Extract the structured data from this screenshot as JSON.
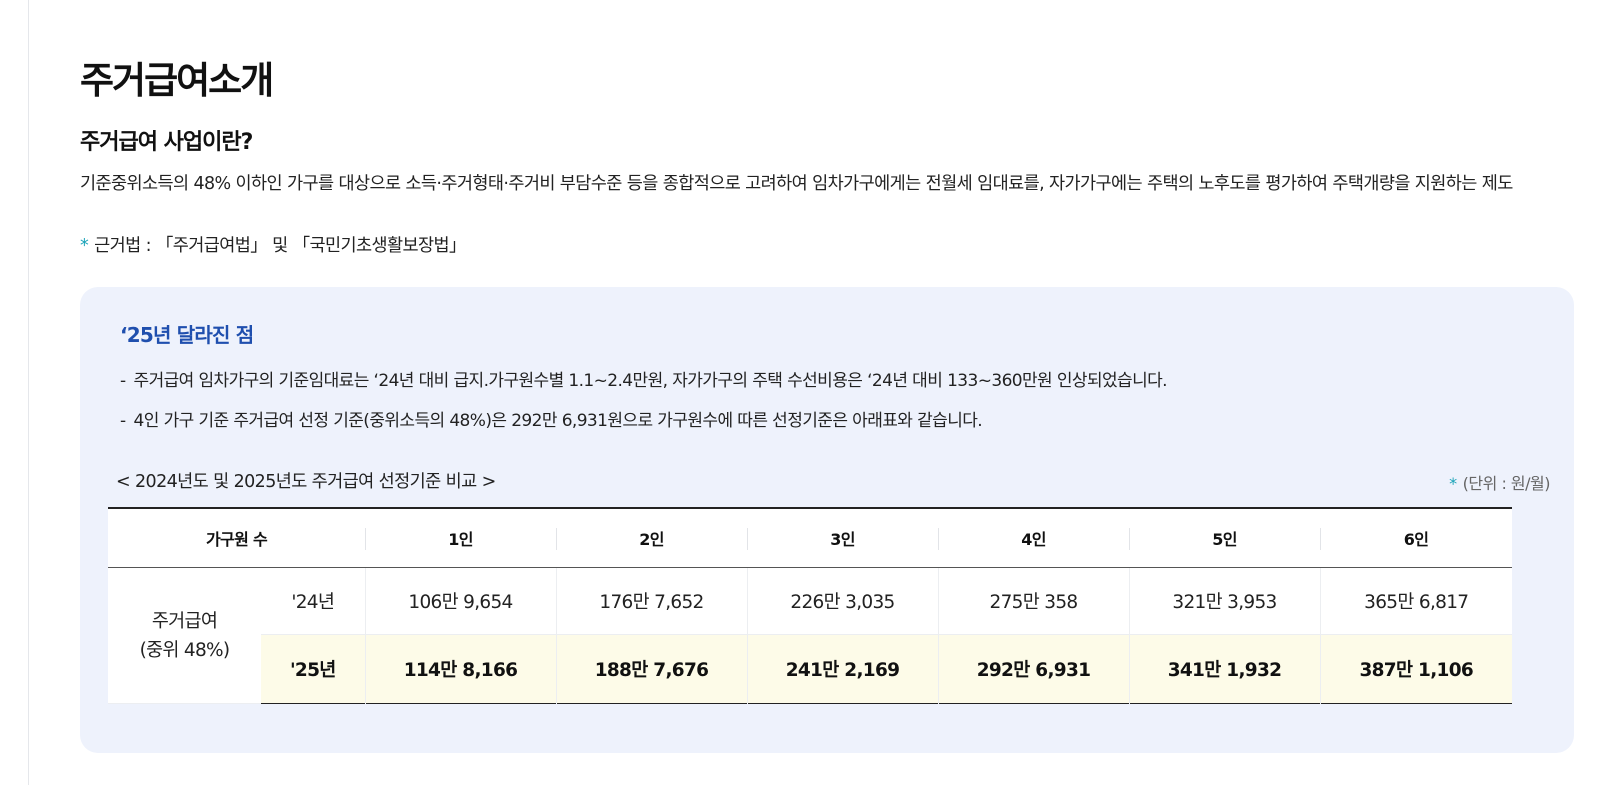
{
  "page": {
    "title": "주거급여소개",
    "subtitle": "주거급여 사업이란?",
    "description": "기준중위소득의 48% 이하인 가구를 대상으로 소득·주거형태·주거비 부담수준 등을 종합적으로 고려하여 임차가구에게는 전월세 임대료를, 자가가구에는 주택의 노후도를 평가하여 주택개량을 지원하는 제도",
    "basis_mark": "*",
    "basis": "근거법 : 「주거급여법」 및 「국민기초생활보장법」"
  },
  "changes": {
    "title": "‘25년 달라진 점",
    "dash": "-",
    "items": [
      "주거급여 임차가구의 기준임대료는 ‘24년 대비 급지.가구원수별 1.1~2.4만원, 자가가구의 주택 수선비용은 ‘24년 대비 133~360만원 인상되었습니다.",
      "4인 가구 기준 주거급여 선정 기준(중위소득의 48%)은 292만 6,931원으로 가구원수에 따른 선정기준은 아래표와 같습니다."
    ]
  },
  "table": {
    "caption": "< 2024년도 및 2025년도 주거급여 선정기준 비교 >",
    "unit_mark": "*",
    "unit": "(단위 : 원/월)",
    "header": [
      "가구원 수",
      "1인",
      "2인",
      "3인",
      "4인",
      "5인",
      "6인"
    ],
    "row_head_line1": "주거급여",
    "row_head_line2": "(중위 48%)",
    "rows": [
      {
        "year": "'24년",
        "values": [
          "106만 9,654",
          "176만 7,652",
          "226만 3,035",
          "275만 358",
          "321만 3,953",
          "365만 6,817"
        ]
      },
      {
        "year": "'25년",
        "values": [
          "114만 8,166",
          "188만 7,676",
          "241만 2,169",
          "292만 6,931",
          "341만 1,932",
          "387만 1,106"
        ]
      }
    ]
  },
  "colors": {
    "panel_bg": "#eef2fc",
    "panel_title": "#1f4fae",
    "accent_star": "#1aa3b8",
    "highlight_row": "#fdfbe8"
  }
}
